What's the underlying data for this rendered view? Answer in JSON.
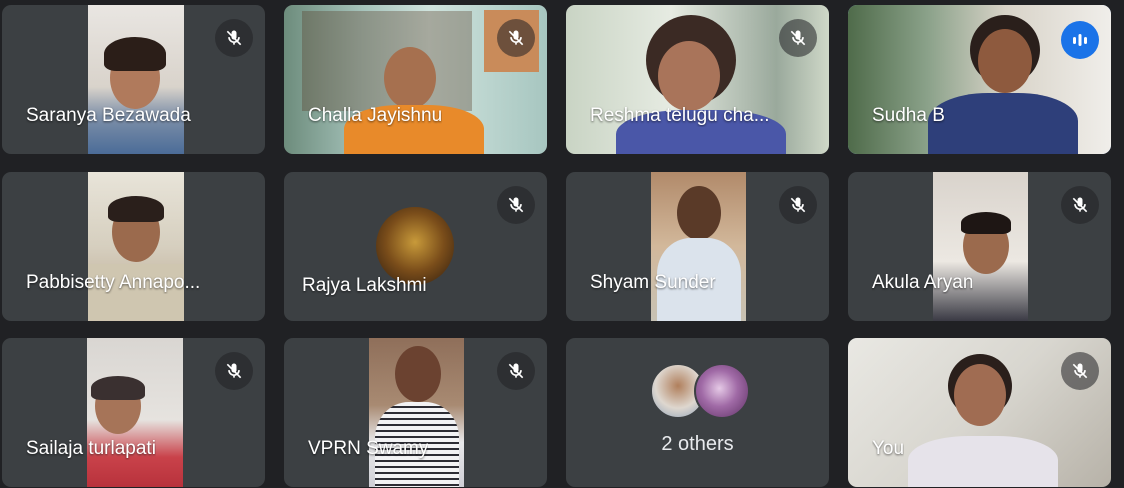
{
  "participants": [
    {
      "name": "Saranya Bezawada",
      "muted": true
    },
    {
      "name": "Challa Jayishnu",
      "muted": true
    },
    {
      "name": "Reshma telugu cha...",
      "muted": true
    },
    {
      "name": "Sudha B",
      "muted": false,
      "speaking": true
    },
    {
      "name": "Pabbisetty Annapo...",
      "muted": false
    },
    {
      "name": "Rajya Lakshmi",
      "muted": true
    },
    {
      "name": "Shyam Sunder",
      "muted": true
    },
    {
      "name": "Akula Aryan",
      "muted": true
    },
    {
      "name": "Sailaja turlapati",
      "muted": true
    },
    {
      "name": "VPRN Swamy",
      "muted": true
    },
    {
      "name": "2 others"
    },
    {
      "name": "You",
      "muted": true
    }
  ],
  "colors": {
    "background": "#202124",
    "tile": "#3c4043",
    "active_speaker": "#8ab4f8",
    "speaking_badge": "#1a73e8"
  }
}
